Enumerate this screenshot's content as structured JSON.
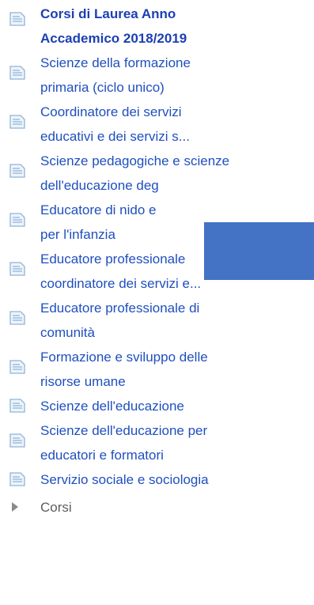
{
  "nav": {
    "header": {
      "line1": "Corsi di Laurea Anno",
      "line2": "Accademico 2018/2019"
    },
    "items": [
      {
        "line1": "Scienze della formazione",
        "line2": "primaria (ciclo unico)"
      },
      {
        "line1": "Coordinatore dei servizi",
        "line2": "educativi e dei servizi s..."
      },
      {
        "line1": "Scienze pedagogiche e scienze",
        "line2": "dell'educazione deg"
      },
      {
        "line1": "Educatore di nido e",
        "line2": "per l'infanzia"
      },
      {
        "line1": "Educatore professionale",
        "line2": "coordinatore dei servizi e..."
      },
      {
        "line1": "Educatore professionale di",
        "line2": "comunità"
      },
      {
        "line1": "Formazione e sviluppo delle",
        "line2": "risorse umane"
      },
      {
        "line1": "Scienze dell'educazione"
      },
      {
        "line1": "Scienze dell'educazione per",
        "line2": "educatori e formatori"
      },
      {
        "line1": "Servizio sociale e sociologia"
      }
    ],
    "collapsed": {
      "label": "Corsi"
    }
  },
  "icons": {
    "page": "document-icon",
    "expand": "triangle-right-icon"
  },
  "colors": {
    "link": "#1f4fbf",
    "header": "#1c3fb4",
    "plain": "#5d5d5d",
    "icon_border": "#8fb3d6",
    "icon_fill": "#eef4fb",
    "redaction": "#4472c4"
  }
}
